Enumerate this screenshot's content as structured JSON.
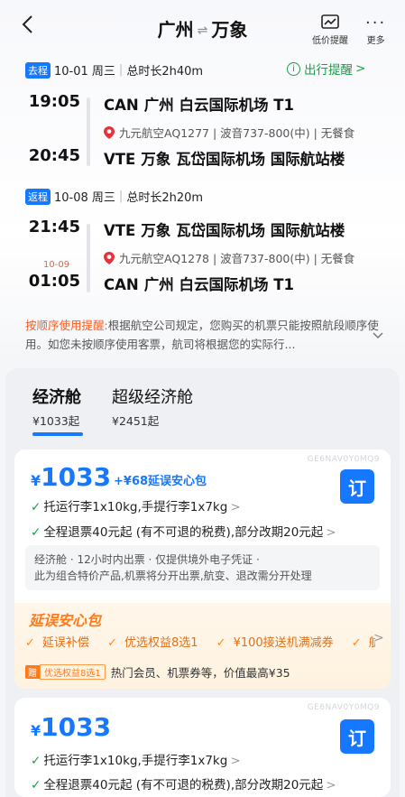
{
  "nav": {
    "back_icon": "chevron-left-icon",
    "origin": "广州",
    "destination": "万象",
    "price_alert_label": "低价提醒",
    "more_label": "更多"
  },
  "outbound": {
    "tag": "去程",
    "date": "10-01 周三",
    "duration": "总时长2h40m",
    "reminder": "出行提醒",
    "dep_time": "19:05",
    "dep_code": "CAN",
    "dep_airport": "广州 白云国际机场 T1",
    "flight_info": "九元航空AQ1277 | 波音737-800(中) | 无餐食",
    "arr_time": "20:45",
    "arr_code": "VTE",
    "arr_airport": "万象 瓦岱国际机场 国际航站楼"
  },
  "return": {
    "tag": "返程",
    "date": "10-08 周三",
    "duration": "总时长2h20m",
    "dep_time": "21:45",
    "dep_code": "VTE",
    "dep_airport": "万象 瓦岱国际机场 国际航站楼",
    "flight_info": "九元航空AQ1278 | 波音737-800(中) | 无餐食",
    "arr_nextday": "10-09",
    "arr_time": "01:05",
    "arr_code": "CAN",
    "arr_airport": "广州 白云国际机场 T1"
  },
  "notice": {
    "title": "按顺序使用提醒:",
    "text": "根据航空公司规定，您购买的机票只能按照航段顺序使用。如您未按顺序使用客票，航司将根据您的实际行..."
  },
  "cabins": [
    {
      "name": "经济舱",
      "price": "¥1033起"
    },
    {
      "name": "超级经济舱",
      "price": "¥2451起"
    }
  ],
  "offers": [
    {
      "code": "GE6NAV0Y0MQ9",
      "currency": "¥",
      "price": "1033",
      "addon": "+¥68延误安心包",
      "book_label": "订",
      "baggage": "托运行李1x10kg,手提行李1x7kg",
      "refund": "全程退票40元起 (有不可退的税费),部分改期20元起",
      "info_line1": "经济舱 · 12小时内出票 · 仅提供境外电子凭证 ·",
      "info_line2": "此为组合特价产品,机票将分开出票,航变、退改需分开处理",
      "promo_title": "延误安心包",
      "promo_items": [
        "延误补偿",
        "优选权益8选1",
        "¥100接送机满减券",
        "航"
      ],
      "gift_tag": "赠",
      "gift_label": "优选权益8选1",
      "gift_text": "热门会员、机票券等，价值最高¥35"
    },
    {
      "code": "GE6NAV0Y0MQ9",
      "currency": "¥",
      "price": "1033",
      "book_label": "订",
      "baggage": "托运行李1x10kg,手提行李1x7kg",
      "refund": "全程退票40元起 (有不可退的税费),部分改期20元起"
    }
  ],
  "colors": {
    "accent": "#1677ff",
    "green": "#1a9e4a",
    "orange": "#ff7a1a"
  }
}
